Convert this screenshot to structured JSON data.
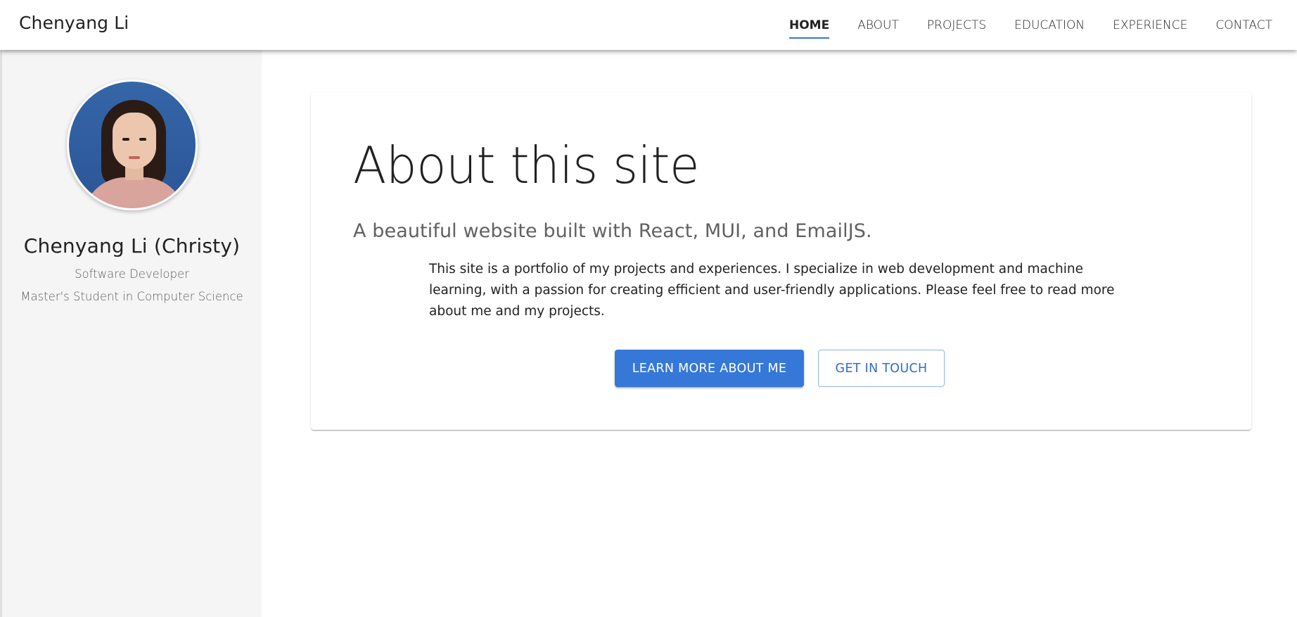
{
  "header": {
    "brand": "Chenyang Li",
    "nav": [
      {
        "label": "HOME",
        "active": true
      },
      {
        "label": "ABOUT",
        "active": false
      },
      {
        "label": "PROJECTS",
        "active": false
      },
      {
        "label": "EDUCATION",
        "active": false
      },
      {
        "label": "EXPERIENCE",
        "active": false
      },
      {
        "label": "CONTACT",
        "active": false
      }
    ]
  },
  "sidebar": {
    "name": "Chenyang Li (Christy)",
    "role": "Software Developer",
    "study": "Master's Student in Computer Science"
  },
  "main": {
    "title": "About this site",
    "subtitle": "A beautiful website built with React, MUI, and EmailJS.",
    "body": "This site is a portfolio of my projects and experiences. I specialize in web development and machine learning, with a passion for creating efficient and user-friendly applications. Please feel free to read more about me and my projects.",
    "primary_button": "LEARN MORE ABOUT ME",
    "secondary_button": "GET IN TOUCH"
  },
  "colors": {
    "accent": "#3578d8",
    "sidebar_bg": "#f5f5f5",
    "text": "#212121",
    "muted_text": "#616161"
  }
}
